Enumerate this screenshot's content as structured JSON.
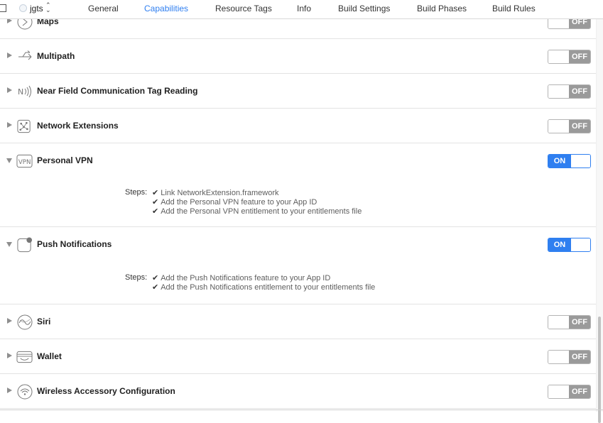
{
  "header": {
    "target_name": "jgts",
    "target_chevron": "⌃⌄",
    "tabs": [
      {
        "label": "General"
      },
      {
        "label": "Capabilities"
      },
      {
        "label": "Resource Tags"
      },
      {
        "label": "Info"
      },
      {
        "label": "Build Settings"
      },
      {
        "label": "Build Phases"
      },
      {
        "label": "Build Rules"
      }
    ],
    "active_tab": "Capabilities"
  },
  "capabilities": [
    {
      "name": "Maps",
      "state": "OFF",
      "icon": "maps-icon"
    },
    {
      "name": "Multipath",
      "state": "OFF",
      "icon": "multipath-icon"
    },
    {
      "name": "Near Field Communication Tag Reading",
      "state": "OFF",
      "icon": "nfc-icon"
    },
    {
      "name": "Network Extensions",
      "state": "OFF",
      "icon": "network-extensions-icon"
    },
    {
      "name": "Personal VPN",
      "state": "ON",
      "icon": "vpn-icon",
      "vpn_icon_text": "VPN"
    },
    {
      "name": "Push Notifications",
      "state": "ON",
      "icon": "push-notifications-icon"
    },
    {
      "name": "Siri",
      "state": "OFF",
      "icon": "siri-icon"
    },
    {
      "name": "Wallet",
      "state": "OFF",
      "icon": "wallet-icon"
    },
    {
      "name": "Wireless Accessory Configuration",
      "state": "OFF",
      "icon": "wireless-accessory-icon"
    }
  ],
  "personal_vpn": {
    "steps_label": "Steps:",
    "steps": [
      "Link NetworkExtension.framework",
      "Add the Personal VPN feature to your App ID",
      "Add the Personal VPN entitlement to your entitlements file"
    ]
  },
  "push_notifications": {
    "steps_label": "Steps:",
    "steps": [
      "Add the Push Notifications feature to your App ID",
      "Add the Push Notifications entitlement to your entitlements file"
    ]
  },
  "colors": {
    "accent": "#2f7ff0",
    "off_label": "#9a9a9a"
  }
}
